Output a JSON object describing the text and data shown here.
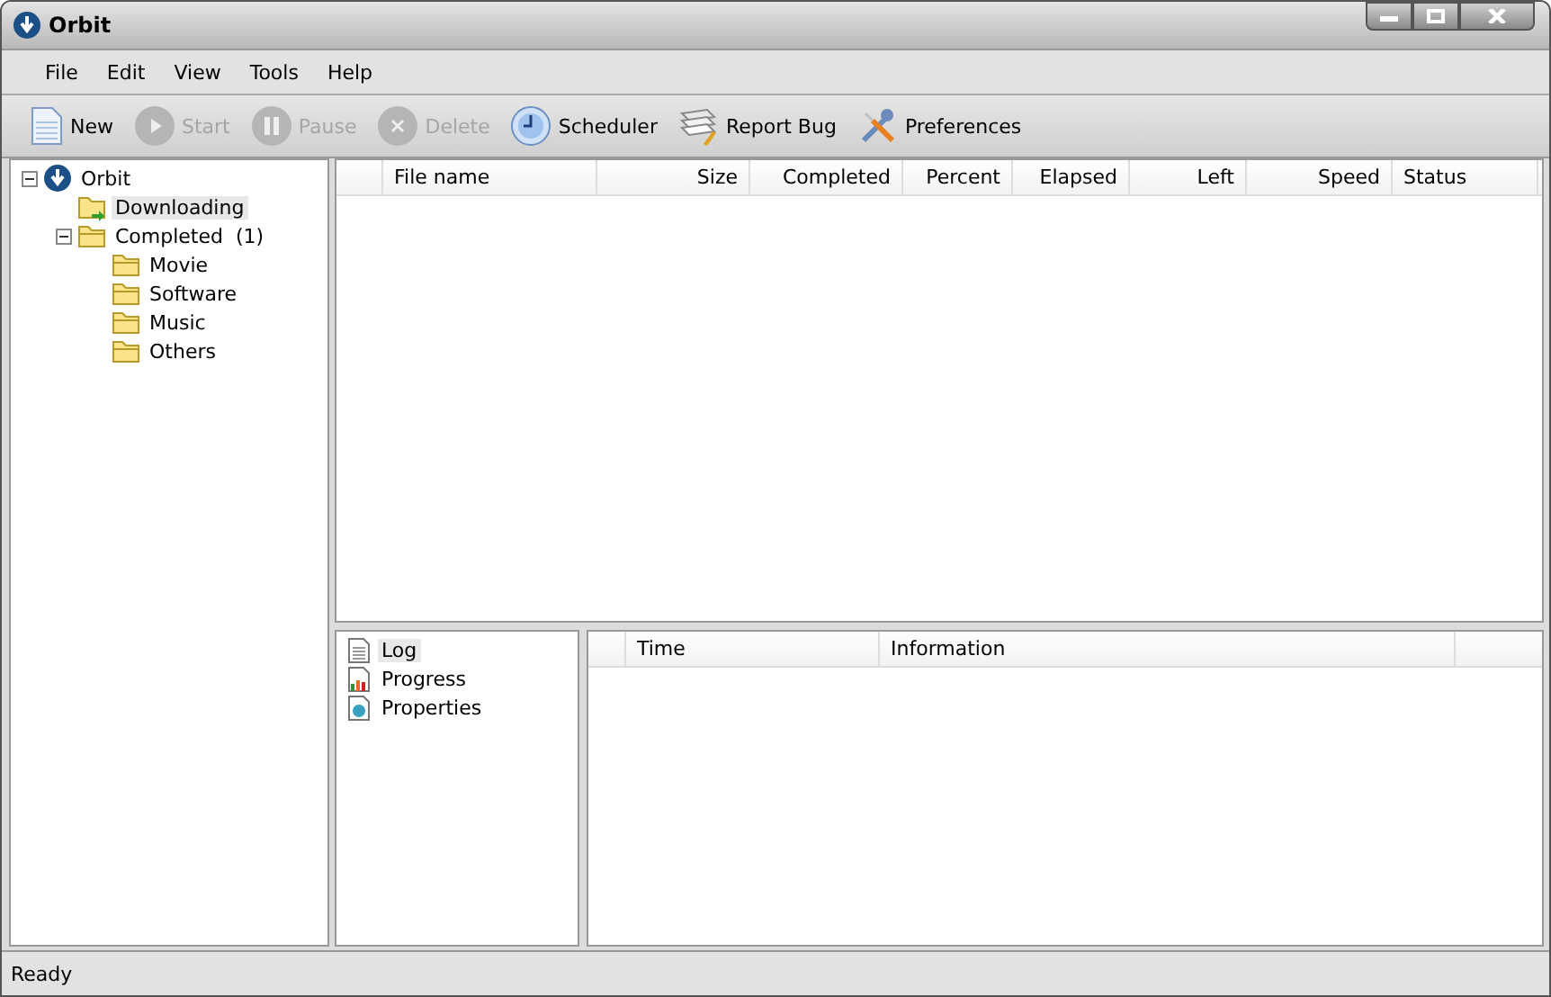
{
  "window": {
    "title": "Orbit"
  },
  "menu": [
    "File",
    "Edit",
    "View",
    "Tools",
    "Help"
  ],
  "toolbar": [
    {
      "label": "New",
      "kind": "new",
      "disabled": false
    },
    {
      "label": "Start",
      "kind": "start",
      "disabled": true
    },
    {
      "label": "Pause",
      "kind": "pause",
      "disabled": true
    },
    {
      "label": "Delete",
      "kind": "delete",
      "disabled": true
    },
    {
      "label": "Scheduler",
      "kind": "clock",
      "disabled": false
    },
    {
      "label": "Report Bug",
      "kind": "bug",
      "disabled": false
    },
    {
      "label": "Preferences",
      "kind": "tools",
      "disabled": false
    }
  ],
  "tree": [
    {
      "label": "Orbit",
      "kind": "app",
      "expanded": true,
      "selected": false,
      "children": [
        {
          "label": "Downloading",
          "kind": "download",
          "selected": true
        },
        {
          "label": "Completed  (1)",
          "kind": "folder",
          "expanded": true,
          "selected": false,
          "children": [
            {
              "label": "Movie",
              "kind": "folder",
              "selected": false
            },
            {
              "label": "Software",
              "kind": "folder",
              "selected": false
            },
            {
              "label": "Music",
              "kind": "folder",
              "selected": false
            },
            {
              "label": "Others",
              "kind": "folder",
              "selected": false
            }
          ]
        }
      ]
    }
  ],
  "table": {
    "columns": [
      "File name",
      "Size",
      "Completed",
      "Percent",
      "Elapsed",
      "Left",
      "Speed",
      "Status"
    ]
  },
  "detail_tabs": [
    {
      "label": "Log",
      "kind": "log",
      "selected": true
    },
    {
      "label": "Progress",
      "kind": "chart",
      "selected": false
    },
    {
      "label": "Properties",
      "kind": "props",
      "selected": false
    }
  ],
  "log_table": {
    "columns": [
      "Time",
      "Information"
    ]
  },
  "status_bar": "Ready"
}
